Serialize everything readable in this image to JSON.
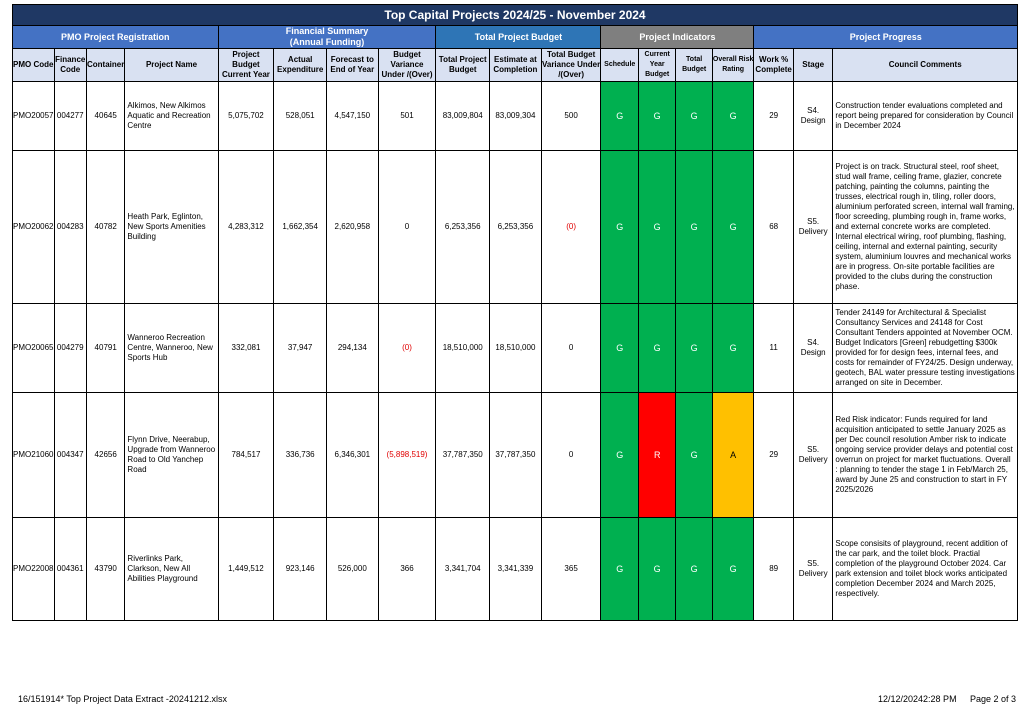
{
  "report": {
    "title": "Top Capital Projects 2024/25 - November 2024",
    "groups": {
      "registration": "PMO Project Registration",
      "financial": "Financial Summary\n(Annual Funding)",
      "budget": "Total Project Budget",
      "indicators": "Project Indicators",
      "progress": "Project Progress"
    },
    "columns": {
      "pmo_code": "PMO Code",
      "finance_code": "Finance Code",
      "container": "Container",
      "project_name": "Project Name",
      "project_budget": "Project Budget Current Year",
      "actual_exp": "Actual Expenditure",
      "forecast": "Forecast to End of Year",
      "budget_var": "Budget Variance Under /(Over)",
      "total_budget": "Total Project Budget",
      "estimate": "Estimate at Completion",
      "total_var": "Total Budget Variance Under /(Over)",
      "schedule": "Schedule",
      "cy_budget": "Current Year Budget",
      "t_budget": "Total Budget",
      "risk": "Overall Risk Rating",
      "work_pct": "Work % Complete",
      "stage": "Stage",
      "comments": "Council Comments"
    }
  },
  "rows": [
    {
      "pmo": "PMO20057",
      "finance": "004277",
      "container": "40645",
      "name": "Alkimos, New Alkimos Aquatic and Recreation Centre",
      "budget_cy": "5,075,702",
      "actual": "528,051",
      "forecast": "4,547,150",
      "variance": "501",
      "total_budget": "83,009,804",
      "estimate": "83,009,304",
      "total_variance": "500",
      "schedule": "G",
      "cy_budget": "G",
      "total_budget_ind": "G",
      "risk": "G",
      "work": "29",
      "stage": "S4. Design",
      "comments": "Construction tender evaluations completed and report being prepared for consideration by Council in December 2024"
    },
    {
      "pmo": "PMO20062",
      "finance": "004283",
      "container": "40782",
      "name": "Heath Park, Eglinton, New Sports Amenities Building",
      "budget_cy": "4,283,312",
      "actual": "1,662,354",
      "forecast": "2,620,958",
      "variance": "0",
      "total_budget": "6,253,356",
      "estimate": "6,253,356",
      "total_variance": "(0)",
      "schedule": "G",
      "cy_budget": "G",
      "total_budget_ind": "G",
      "risk": "G",
      "work": "68",
      "stage": "S5. Delivery",
      "comments": "Project is on track. Structural steel, roof sheet, stud wall frame, ceiling frame, glazier, concrete patching, painting the columns, painting the trusses, electrical rough in, tiling, roller doors, aluminium perforated screen, internal wall framing, floor screeding, plumbing rough in, frame works, and external concrete works are completed. Internal electrical wiring, roof plumbing, flashing, ceiling, internal and external painting, security system, aluminium louvres and mechanical works are in progress. On-site portable facilities are provided to the clubs during the construction phase."
    },
    {
      "pmo": "PMO20065",
      "finance": "004279",
      "container": "40791",
      "name": "Wanneroo Recreation Centre, Wanneroo, New Sports Hub",
      "budget_cy": "332,081",
      "actual": "37,947",
      "forecast": "294,134",
      "variance": "(0)",
      "total_budget": "18,510,000",
      "estimate": "18,510,000",
      "total_variance": "0",
      "schedule": "G",
      "cy_budget": "G",
      "total_budget_ind": "G",
      "risk": "G",
      "work": "11",
      "stage": "S4. Design",
      "comments": "Tender 24149 for Architectural & Specialist Consultancy Services and 24148 for Cost Consultant Tenders appointed at November OCM. Budget Indicators [Green] rebudgetting $300k provided for for design fees, internal fees, and costs for remainder of FY24/25. Design underway, geotech, BAL water pressure testing investigations arranged on site in December."
    },
    {
      "pmo": "PMO21060",
      "finance": "004347",
      "container": "42656",
      "name": "Flynn Drive, Neerabup, Upgrade from Wanneroo Road to Old Yanchep Road",
      "budget_cy": "784,517",
      "actual": "336,736",
      "forecast": "6,346,301",
      "variance": "(5,898,519)",
      "total_budget": "37,787,350",
      "estimate": "37,787,350",
      "total_variance": "0",
      "schedule": "G",
      "cy_budget": "R",
      "total_budget_ind": "G",
      "risk": "A",
      "work": "29",
      "stage": "S5. Delivery",
      "comments": "Red Risk indicator: Funds required for land acquisition anticipated to settle January 2025 as per Dec council resolution Amber risk to indicate ongoing service provider delays and potential cost overrun on project for market fluctuations. Overall : planning to tender the stage 1 in Feb/March 25, award by June 25 and construction to start in FY 2025/2026"
    },
    {
      "pmo": "PMO22008",
      "finance": "004361",
      "container": "43790",
      "name": "Riverlinks Park, Clarkson, New All Abilities Playground",
      "budget_cy": "1,449,512",
      "actual": "923,146",
      "forecast": "526,000",
      "variance": "366",
      "total_budget": "3,341,704",
      "estimate": "3,341,339",
      "total_variance": "365",
      "schedule": "G",
      "cy_budget": "G",
      "total_budget_ind": "G",
      "risk": "G",
      "work": "89",
      "stage": "S5. Delivery",
      "comments": "Scope consisits of playground, recent addition of the car park, and the toilet block. Practial completion of the playground October 2024. Car park extension and toilet block works anticipated completion December 2024 and March 2025, respectively."
    }
  ],
  "footer": {
    "left": "16/151914*  Top Project Data Extract -20241212.xlsx",
    "datetime": "12/12/20242:28 PM",
    "page": "Page 2 of 3"
  },
  "colors": {
    "title_bg": "#1f3864",
    "group_bg": "#4472c4",
    "header_bg": "#d9e1f2",
    "green": "#00b050",
    "red": "#ff0000",
    "amber": "#ffc000"
  }
}
